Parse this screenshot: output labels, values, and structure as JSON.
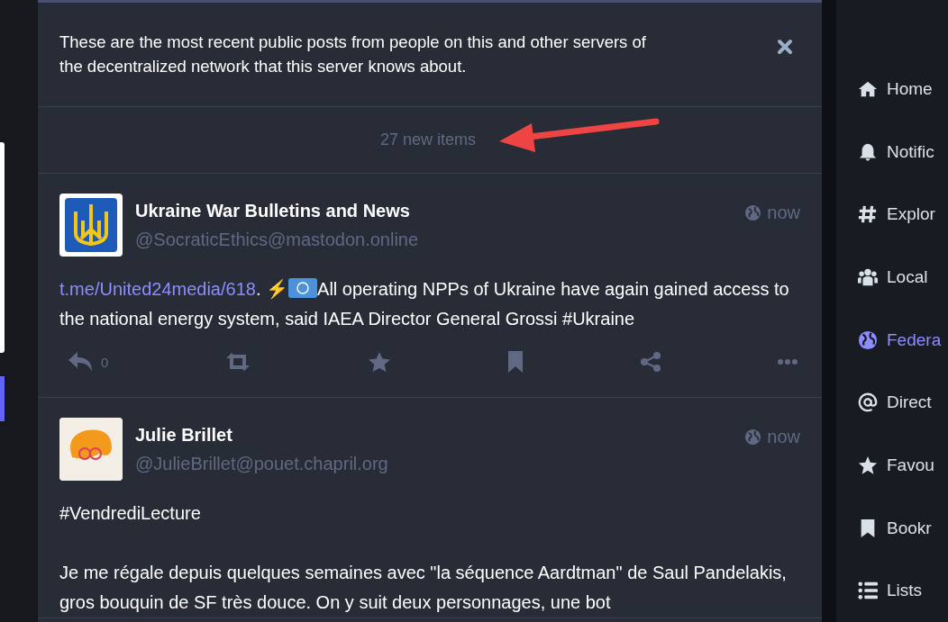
{
  "explanation": {
    "text": "These are the most recent public posts from people on this and other servers of the decentralized network that this server knows about."
  },
  "new_items": {
    "label": "27 new items"
  },
  "annotation": {
    "kind": "arrow"
  },
  "posts": [
    {
      "name": "Ukraine War Bulletins and News",
      "handle": "@SocraticEthics@mastodon.online",
      "time": "now",
      "paragraphs": [
        [
          {
            "kind": "link",
            "text": "t.me/United24media/618"
          },
          {
            "kind": "text",
            "text": ". ⚡"
          },
          {
            "kind": "flag"
          },
          {
            "kind": "text",
            "text": "All operating NPPs of Ukraine have again gained access to the national energy system, said IAEA Director General Grossi #Ukraine"
          }
        ]
      ],
      "actions": {
        "replies": "0"
      }
    },
    {
      "name": "Julie Brillet",
      "handle": "@JulieBrillet@pouet.chapril.org",
      "time": "now",
      "paragraphs": [
        [
          {
            "kind": "text",
            "text": "#VendrediLecture"
          }
        ],
        [
          {
            "kind": "text",
            "text": "Je me régale depuis quelques semaines avec \"la séquence Aardtman\" de Saul Pandelakis, gros bouquin de SF très douce. On y suit deux personnages, une bot"
          }
        ]
      ]
    }
  ],
  "nav": [
    {
      "label": "Home",
      "selected": false
    },
    {
      "label": "Notific",
      "selected": false
    },
    {
      "label": "Explor",
      "selected": false
    },
    {
      "label": "Local",
      "selected": false
    },
    {
      "label": "Federa",
      "selected": true
    },
    {
      "label": "Direct",
      "selected": false
    },
    {
      "label": "Favou",
      "selected": false
    },
    {
      "label": "Bookr",
      "selected": false
    },
    {
      "label": "Lists",
      "selected": false
    }
  ]
}
